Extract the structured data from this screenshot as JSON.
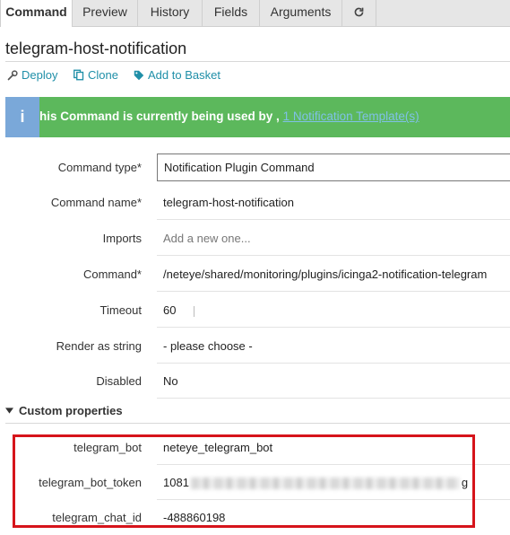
{
  "tabs": [
    {
      "label": "Command",
      "active": true
    },
    {
      "label": "Preview"
    },
    {
      "label": "History"
    },
    {
      "label": "Fields"
    },
    {
      "label": "Arguments"
    }
  ],
  "tab_refresh_icon": "refresh-icon",
  "page_title": "telegram-host-notification",
  "actions": {
    "deploy": "Deploy",
    "clone": "Clone",
    "add_to_basket": "Add to Basket"
  },
  "banner": {
    "icon": "info-icon",
    "text": "his Command is currently being used by ,",
    "link": "1 Notification Template(s)",
    "color": "#5cb85c"
  },
  "form": {
    "command_type": {
      "label": "Command type*",
      "value": "Notification Plugin Command"
    },
    "command_name": {
      "label": "Command name*",
      "value": "telegram-host-notification"
    },
    "imports": {
      "label": "Imports",
      "placeholder": "Add a new one..."
    },
    "command": {
      "label": "Command*",
      "value": "/neteye/shared/monitoring/plugins/icinga2-notification-telegram"
    },
    "timeout": {
      "label": "Timeout",
      "value": "60"
    },
    "render_as_string": {
      "label": "Render as string",
      "value": "- please choose -"
    },
    "disabled": {
      "label": "Disabled",
      "value": "No"
    }
  },
  "custom_properties": {
    "heading": "Custom properties",
    "items": [
      {
        "label": "telegram_bot",
        "value": "neteye_telegram_bot"
      },
      {
        "label": "telegram_bot_token",
        "value_prefix": "1081",
        "value_suffix": "g"
      },
      {
        "label": "telegram_chat_id",
        "value": "-488860198"
      }
    ]
  },
  "colors": {
    "link": "#1f8fa8",
    "highlight_border": "#d6141b"
  }
}
